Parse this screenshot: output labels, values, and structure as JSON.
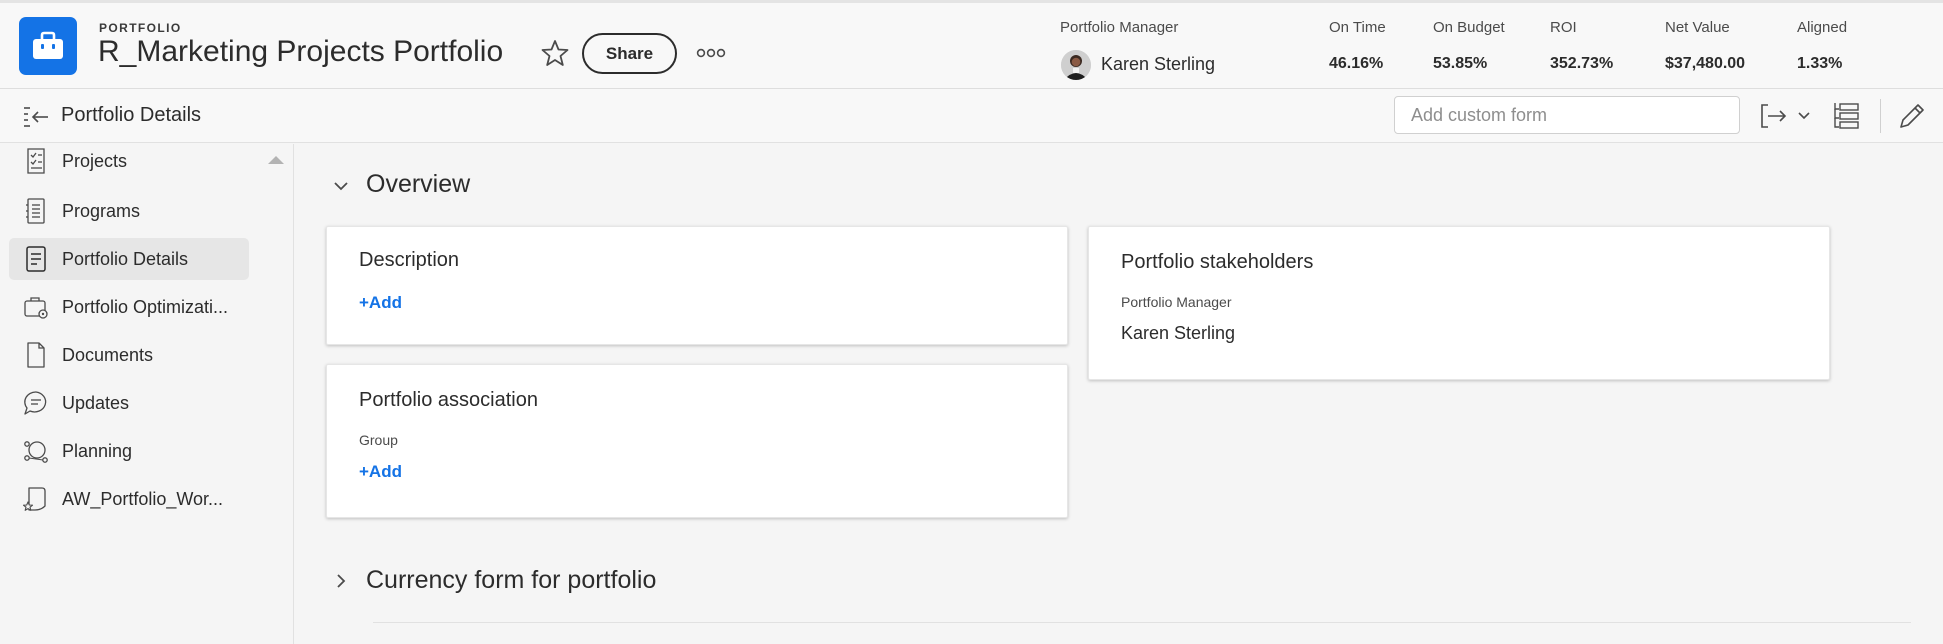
{
  "header": {
    "type_label": "PORTFOLIO",
    "title": "R_Marketing Projects Portfolio",
    "share_label": "Share",
    "icons": {
      "app": "briefcase-icon",
      "favorite": "star-icon",
      "more": "more-dots-icon"
    },
    "portfolio_manager": {
      "label": "Portfolio Manager",
      "name": "Karen Sterling"
    },
    "metrics": [
      {
        "label": "On Time",
        "value": "46.16%"
      },
      {
        "label": "On Budget",
        "value": "53.85%"
      },
      {
        "label": "ROI",
        "value": "352.73%"
      },
      {
        "label": "Net Value",
        "value": "$37,480.00"
      },
      {
        "label": "Aligned",
        "value": "1.33%"
      }
    ]
  },
  "subheader": {
    "title": "Portfolio Details",
    "custom_form_placeholder": "Add custom form",
    "icons": [
      "collapse-panel-icon",
      "export-icon",
      "chevron-down-icon",
      "list-view-icon",
      "edit-pencil-icon"
    ]
  },
  "sidebar": {
    "items": [
      {
        "label": "Projects",
        "icon": "projects-checklist-icon",
        "active": false
      },
      {
        "label": "Programs",
        "icon": "programs-list-icon",
        "active": false
      },
      {
        "label": "Portfolio Details",
        "icon": "details-document-icon",
        "active": true
      },
      {
        "label": "Portfolio Optimizati...",
        "icon": "optimizer-briefcase-icon",
        "active": false
      },
      {
        "label": "Documents",
        "icon": "document-icon",
        "active": false
      },
      {
        "label": "Updates",
        "icon": "chat-bubble-icon",
        "active": false
      },
      {
        "label": "Planning",
        "icon": "planning-scenario-icon",
        "active": false
      },
      {
        "label": "AW_Portfolio_Wor...",
        "icon": "workfront-form-icon",
        "active": false
      }
    ]
  },
  "main": {
    "overview_title": "Overview",
    "description": {
      "title": "Description",
      "add_label": "+Add"
    },
    "association": {
      "title": "Portfolio association",
      "field_label": "Group",
      "add_label": "+Add"
    },
    "stakeholders": {
      "title": "Portfolio stakeholders",
      "field_label": "Portfolio Manager",
      "field_value": "Karen Sterling"
    },
    "currency_section_title": "Currency form for portfolio"
  },
  "colors": {
    "accent": "#1473e6",
    "text": "#2c2c2c",
    "background": "#f5f5f5"
  }
}
